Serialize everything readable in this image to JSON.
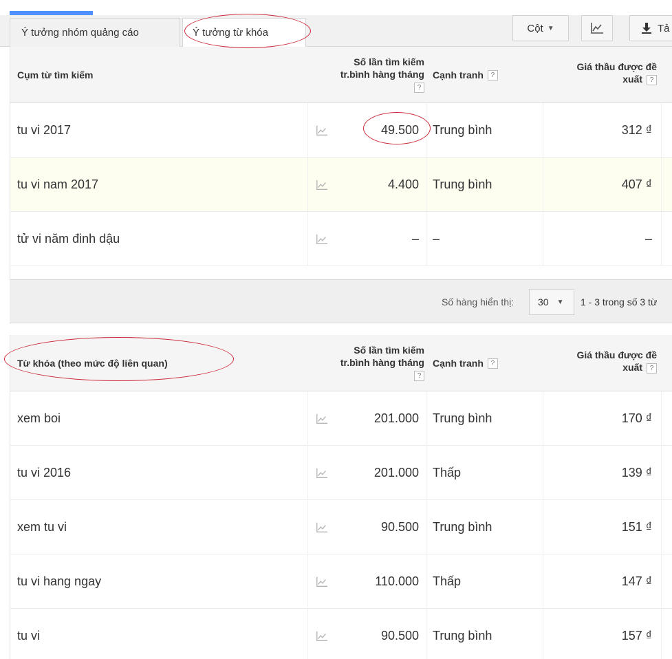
{
  "tabs": [
    {
      "label": "Ý tưởng nhóm quảng cáo",
      "active": false
    },
    {
      "label": "Ý tưởng từ khóa",
      "active": true
    }
  ],
  "toolbar": {
    "columns_label": "Cột",
    "download_label": "Tả"
  },
  "table1": {
    "headers": {
      "term": "Cụm từ tìm kiếm",
      "volume_line1": "Số lần tìm kiếm",
      "volume_line2": "tr.bình hàng tháng",
      "competition": "Cạnh tranh",
      "bid_line1": "Giá thầu được đề",
      "bid_line2": "xuất",
      "help": "?"
    },
    "rows": [
      {
        "term": "tu vi 2017",
        "volume": "49.500",
        "competition": "Trung bình",
        "bid": "312 ₫"
      },
      {
        "term": "tu vi nam 2017",
        "volume": "4.400",
        "competition": "Trung bình",
        "bid": "407 ₫"
      },
      {
        "term": "tử vi năm đinh dậu",
        "volume": "–",
        "competition": "–",
        "bid": "–"
      }
    ]
  },
  "pagination": {
    "rows_label": "Số hàng hiển thị:",
    "rows_value": "30",
    "range_text": "1 - 3 trong số 3 từ"
  },
  "table2": {
    "headers": {
      "term": "Từ khóa (theo mức độ liên quan)",
      "volume_line1": "Số lần tìm kiếm",
      "volume_line2": "tr.bình hàng tháng",
      "competition": "Cạnh tranh",
      "bid_line1": "Giá thầu được đề",
      "bid_line2": "xuất",
      "help": "?"
    },
    "rows": [
      {
        "term": "xem boi",
        "volume": "201.000",
        "competition": "Trung bình",
        "bid": "170 ₫"
      },
      {
        "term": "tu vi 2016",
        "volume": "201.000",
        "competition": "Thấp",
        "bid": "139 ₫"
      },
      {
        "term": "xem tu vi",
        "volume": "90.500",
        "competition": "Trung bình",
        "bid": "151 ₫"
      },
      {
        "term": "tu vi hang ngay",
        "volume": "110.000",
        "competition": "Thấp",
        "bid": "147 ₫"
      },
      {
        "term": "tu vi",
        "volume": "90.500",
        "competition": "Trung bình",
        "bid": "157 ₫"
      }
    ]
  },
  "colors": {
    "accent": "#4d90fe",
    "annotation": "#cc2a3a",
    "highlight_row": "#fdfdf0"
  }
}
